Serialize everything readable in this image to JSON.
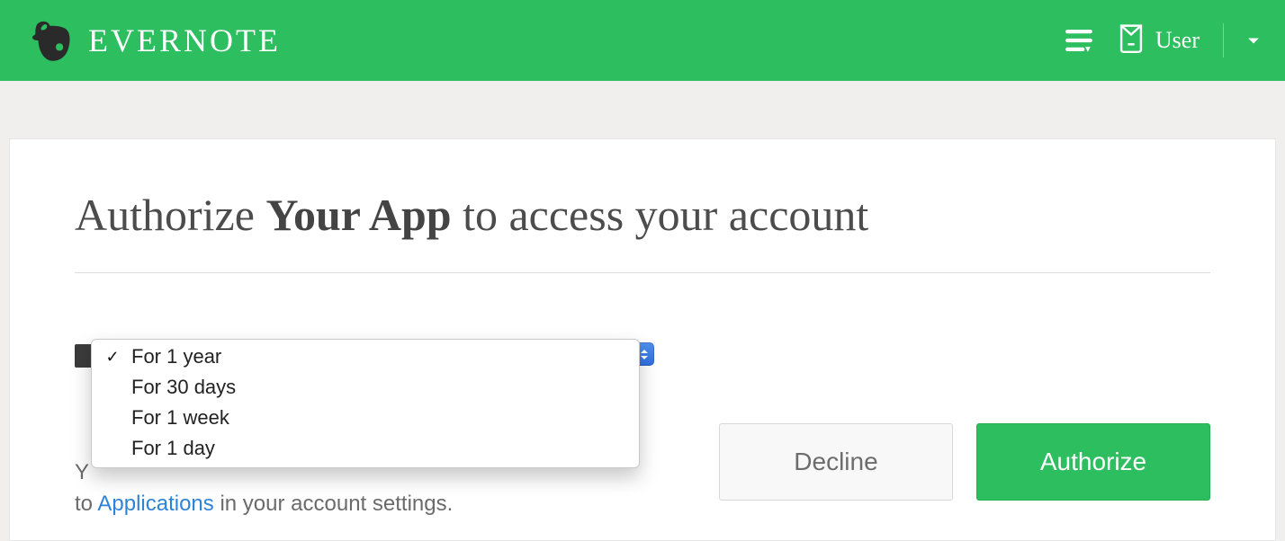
{
  "header": {
    "brand": "EVERNOTE",
    "user_label": "User"
  },
  "main": {
    "title_prefix": "Authorize",
    "title_app": "Your App",
    "title_suffix": "to access your account"
  },
  "dropdown": {
    "options": [
      {
        "label": "For 1 year",
        "selected": true
      },
      {
        "label": "For 30 days",
        "selected": false
      },
      {
        "label": "For 1 week",
        "selected": false
      },
      {
        "label": "For 1 day",
        "selected": false
      }
    ]
  },
  "revoke": {
    "line1_visible": "Y",
    "line2_prefix": "to ",
    "link": "Applications",
    "line2_suffix": " in your account settings."
  },
  "actions": {
    "decline": "Decline",
    "authorize": "Authorize"
  },
  "colors": {
    "brand_green": "#2dbe60",
    "link_blue": "#2f83d6"
  }
}
